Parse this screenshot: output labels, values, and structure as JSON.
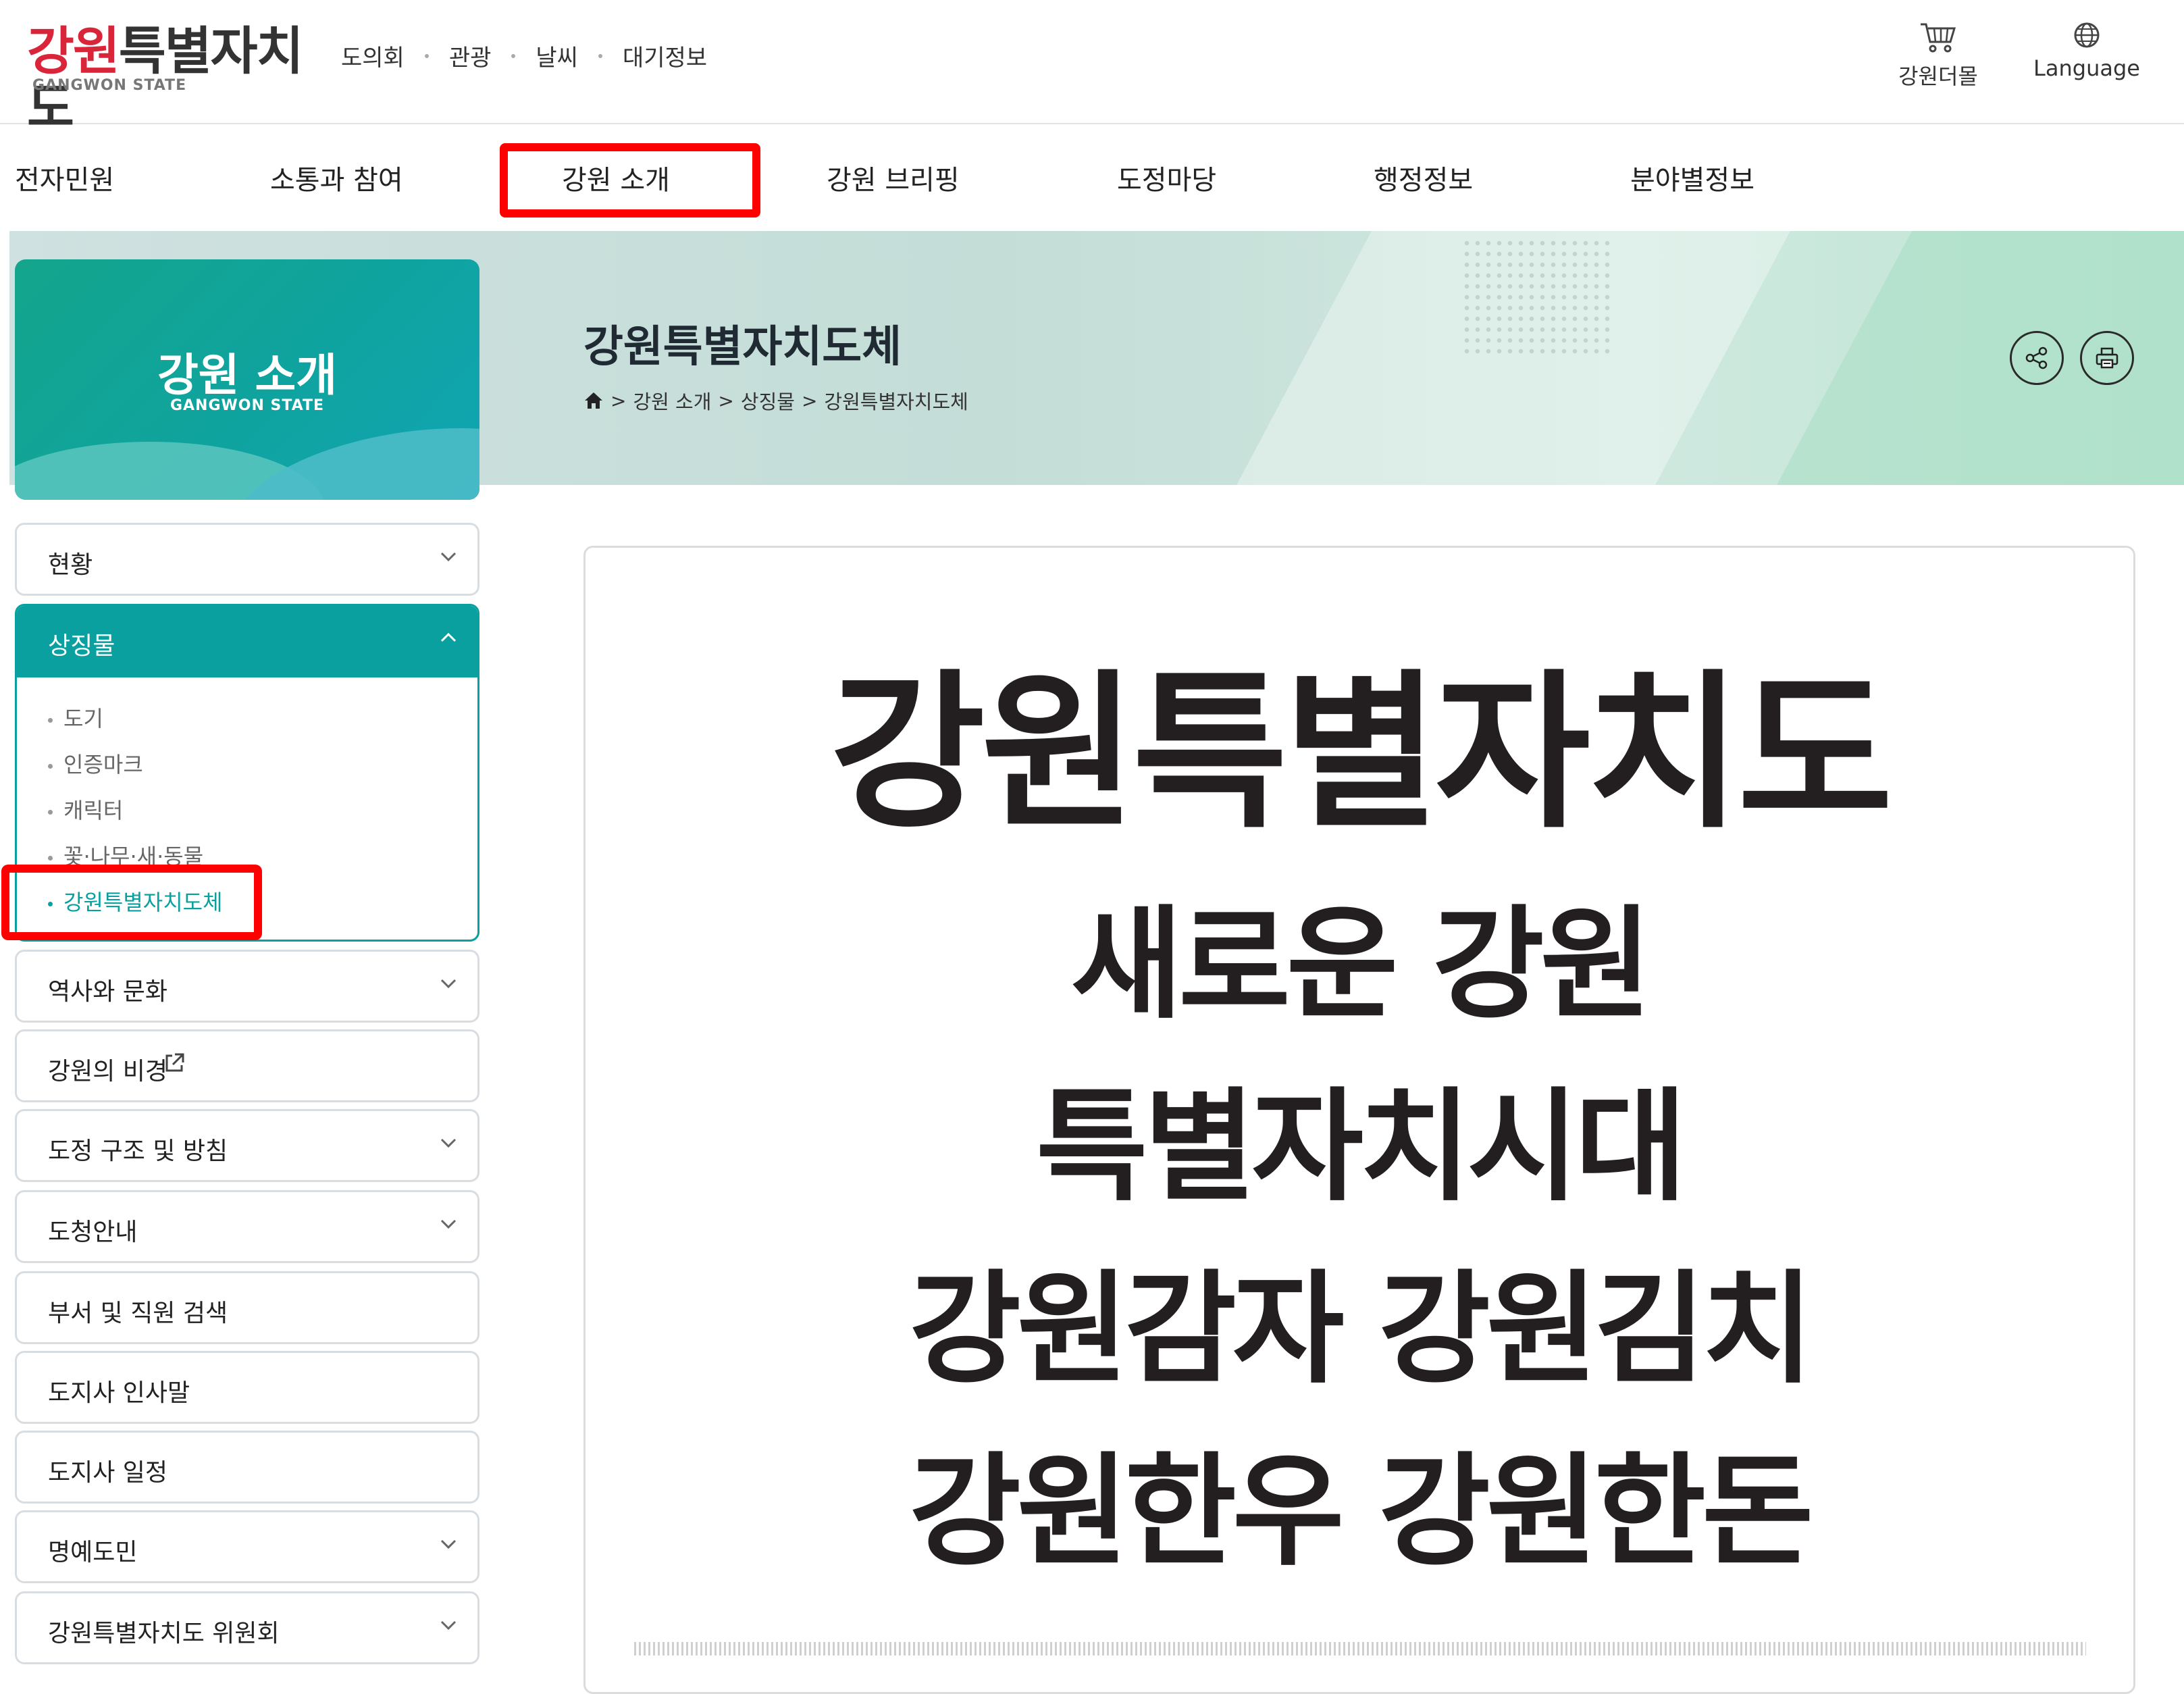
{
  "header": {
    "logo_main": "강원특별자치도",
    "logo_sub": "GANGWON STATE",
    "top_links": [
      "도의회",
      "관광",
      "날씨",
      "대기정보"
    ],
    "mall_label": "강원더몰",
    "mall_icon": "cart-icon",
    "language_label": "Language",
    "language_icon": "globe-icon"
  },
  "gnb": {
    "items": [
      "전자민원",
      "소통과 참여",
      "강원 소개",
      "강원 브리핑",
      "도정마당",
      "행정정보",
      "분야별정보"
    ],
    "active": "강원 소개"
  },
  "banner": {
    "title": "강원특별자치도체",
    "breadcrumb": [
      "강원 소개",
      "상징물",
      "강원특별자치도체"
    ],
    "home_icon": "home-icon",
    "share_icon": "share-icon",
    "print_icon": "printer-icon"
  },
  "sidebar": {
    "title": "강원 소개",
    "subtitle": "GANGWON STATE",
    "menus": [
      {
        "label": "현황",
        "state": "collapsed"
      },
      {
        "label": "상징물",
        "state": "expanded",
        "children": [
          "도기",
          "인증마크",
          "캐릭터",
          "꽃·나무·새·동물",
          "강원특별자치도체"
        ],
        "active_child": "강원특별자치도체"
      },
      {
        "label": "역사와 문화",
        "state": "collapsed"
      },
      {
        "label": "강원의 비경",
        "state": "external"
      },
      {
        "label": "도정 구조 및 방침",
        "state": "collapsed"
      },
      {
        "label": "도청안내",
        "state": "collapsed"
      },
      {
        "label": "부서 및 직원 검색",
        "state": "none"
      },
      {
        "label": "도지사 인사말",
        "state": "none"
      },
      {
        "label": "도지사 일정",
        "state": "none"
      },
      {
        "label": "명예도민",
        "state": "collapsed"
      },
      {
        "label": "강원특별자치도 위원회",
        "state": "collapsed"
      }
    ]
  },
  "content": {
    "sample_lines": [
      "강원특별자치도",
      "새로운 강원",
      "특별자치시대",
      "강원감자 강원김치",
      "강원한우 강원한돈"
    ]
  },
  "colors": {
    "brand_red": "#d9253a",
    "accent_teal": "#0aa0a0",
    "highlight_red": "#ff0000",
    "text_dark": "#231f20"
  }
}
